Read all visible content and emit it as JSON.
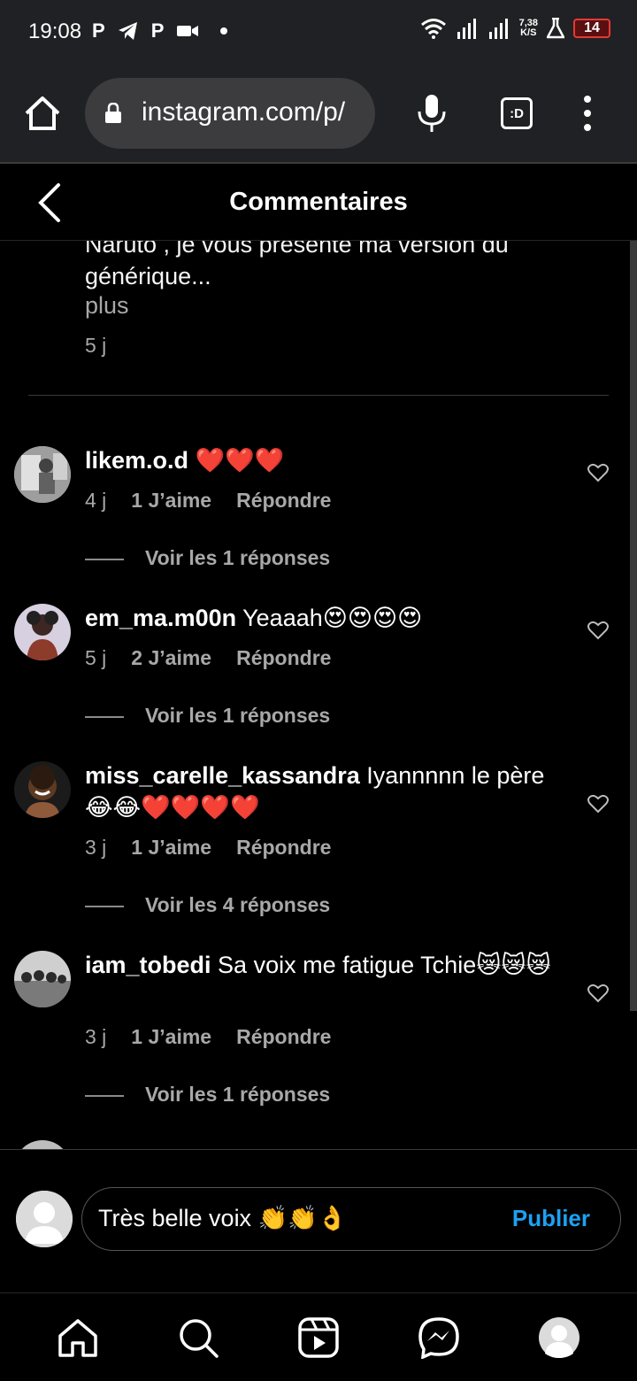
{
  "status_bar": {
    "time": "19:08",
    "left_glyphs": [
      "P",
      "P"
    ],
    "net_speed_top": "7,38",
    "net_speed_bottom": "K/S",
    "battery": "14"
  },
  "browser": {
    "url": "instagram.com/p/",
    "tabs_label": ":D"
  },
  "header": {
    "title": "Commentaires"
  },
  "caption": {
    "text": "Naruto , je vous présente ma version du générique...",
    "more": "plus",
    "age": "5 j"
  },
  "comments": [
    {
      "username": "likem.o.d",
      "text": "❤️❤️❤️",
      "age": "4 j",
      "likes": "1 J’aime",
      "reply": "Répondre",
      "view_replies": "Voir les 1 réponses"
    },
    {
      "username": "em_ma.m00n",
      "text": "Yeaaah😍😍😍😍",
      "age": "5 j",
      "likes": "2 J’aime",
      "reply": "Répondre",
      "view_replies": "Voir les 1 réponses"
    },
    {
      "username": "miss_carelle_kassandra",
      "text": "Iyannnnn le père 😂😂❤️❤️❤️❤️",
      "age": "3 j",
      "likes": "1 J’aime",
      "reply": "Répondre",
      "view_replies": "Voir les 4 réponses"
    },
    {
      "username": "iam_tobedi",
      "text": "Sa voix me fatigue Tchie😿😿😿",
      "age": "3 j",
      "likes": "1 J’aime",
      "reply": "Répondre",
      "view_replies": "Voir les 1 réponses"
    }
  ],
  "composer": {
    "value": "Très belle voix 👏👏👌",
    "publish_label": "Publier"
  },
  "colors": {
    "background": "#000000",
    "chrome": "#202124",
    "publish_blue": "#1da1f2",
    "muted_text": "#a8a8a8"
  },
  "icons": [
    "home-icon",
    "search-icon",
    "reels-icon",
    "messenger-icon",
    "profile-avatar-icon"
  ]
}
